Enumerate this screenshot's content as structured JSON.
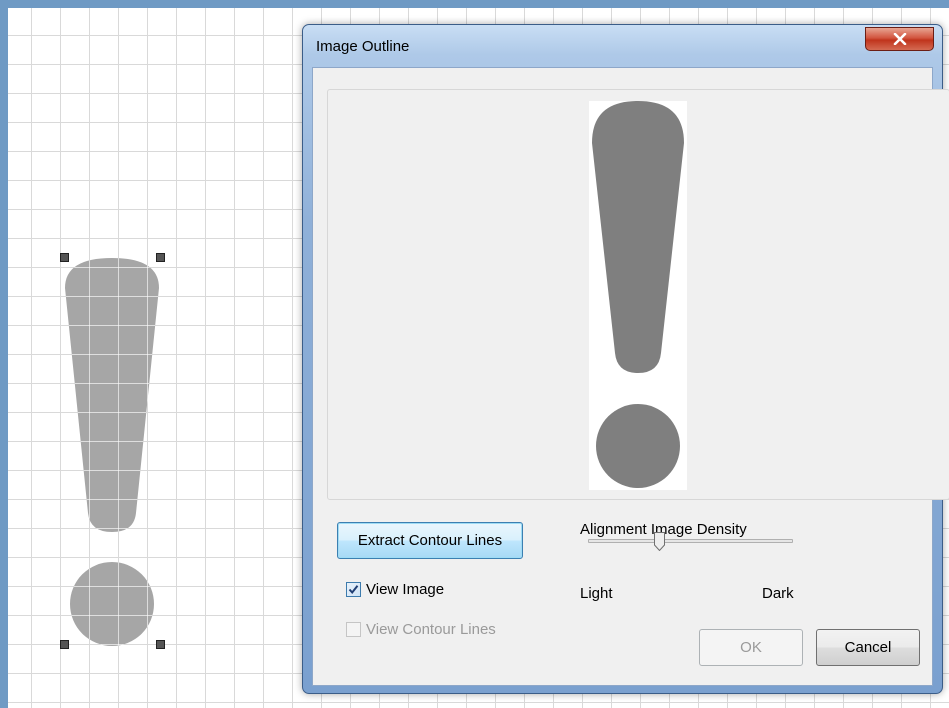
{
  "dialog": {
    "title": "Image Outline",
    "buttons": {
      "extract": "Extract Contour Lines",
      "ok": "OK",
      "cancel": "Cancel"
    },
    "checkboxes": {
      "view_image": {
        "label": "View Image",
        "checked": true
      },
      "view_contour": {
        "label": "View Contour Lines",
        "checked": false,
        "disabled": true
      }
    },
    "slider": {
      "title": "Alignment Image Density",
      "min_label": "Light",
      "max_label": "Dark",
      "value_fraction": 0.35
    }
  },
  "colors": {
    "shape_gray": "#a6a6a6",
    "preview_shape": "#7f7f7f",
    "accent_blue": "#3c7fb1"
  },
  "icons": {
    "close": "close-x-icon",
    "check": "checkmark-icon"
  }
}
